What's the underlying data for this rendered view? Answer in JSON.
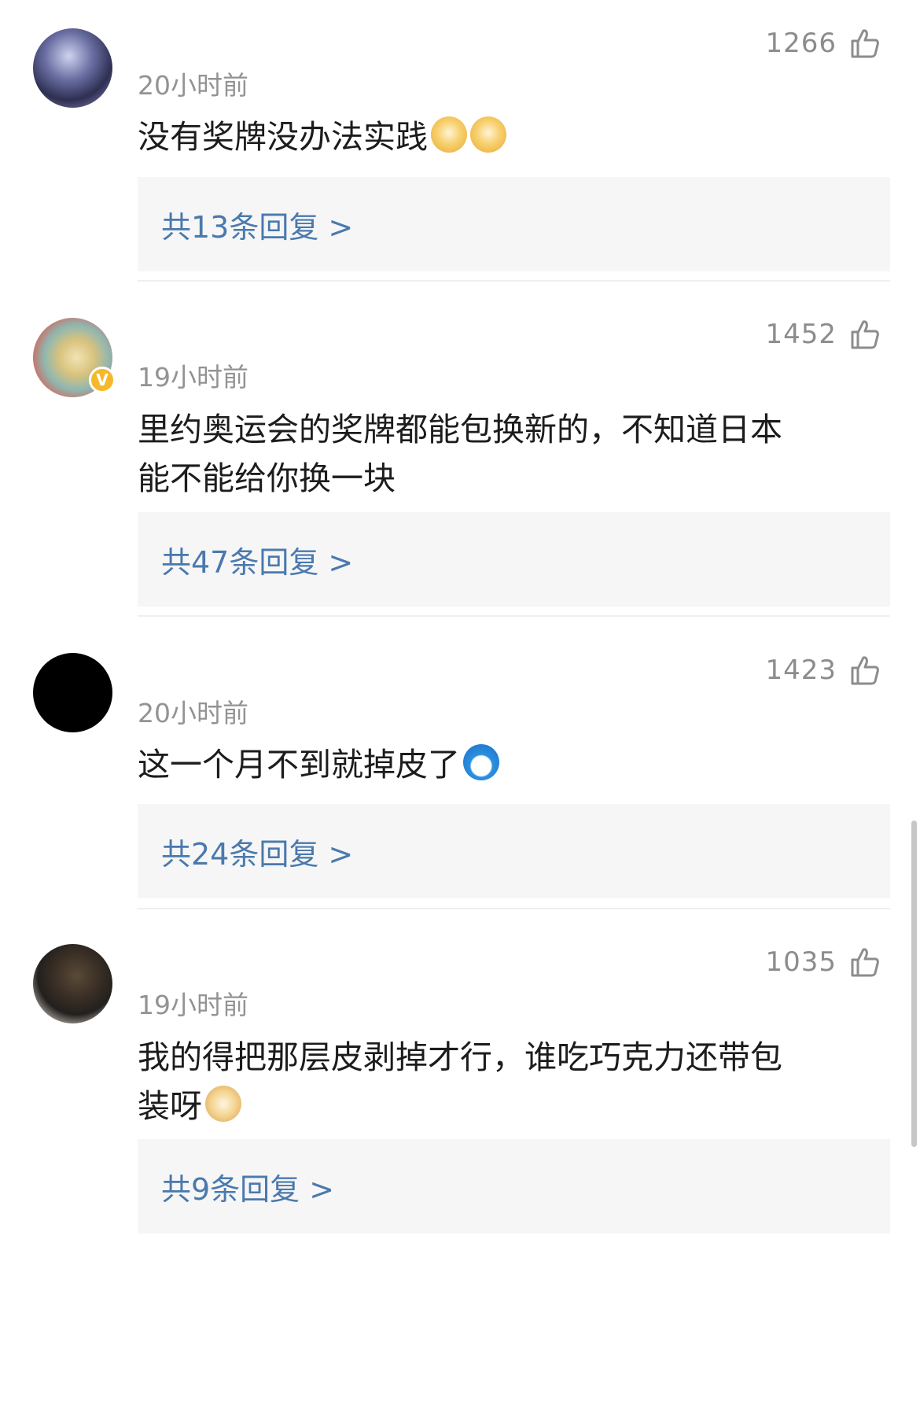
{
  "comments": [
    {
      "likes": "1266",
      "time": "20小时前",
      "text": "没有奖牌没办法实践",
      "emojis": [
        "dog-crying-emoji",
        "dog-crying-emoji"
      ],
      "replies": "共13条回复 >"
    },
    {
      "likes": "1452",
      "time": "19小时前",
      "verified_badge": "V",
      "text_line1": "里约奥运会的奖牌都能包换新的，不知道日本",
      "text_line2": "能不能给你换一块",
      "replies": "共47条回复 >"
    },
    {
      "likes": "1423",
      "time": "20小时前",
      "text": "这一个月不到就掉皮了",
      "emojis": [
        "doraemon-emoji"
      ],
      "replies": "共24条回复 >"
    },
    {
      "likes": "1035",
      "time": "19小时前",
      "text_line1": "我的得把那层皮剥掉才行，谁吃巧克力还带包",
      "text_line2": "装呀",
      "emojis": [
        "doge-emoji"
      ],
      "replies": "共9条回复 >"
    }
  ],
  "colors": {
    "reply_link": "#4a79ad",
    "reply_bg": "#f6f6f6",
    "meta_text": "#939393",
    "badge": "#f5b82a"
  }
}
